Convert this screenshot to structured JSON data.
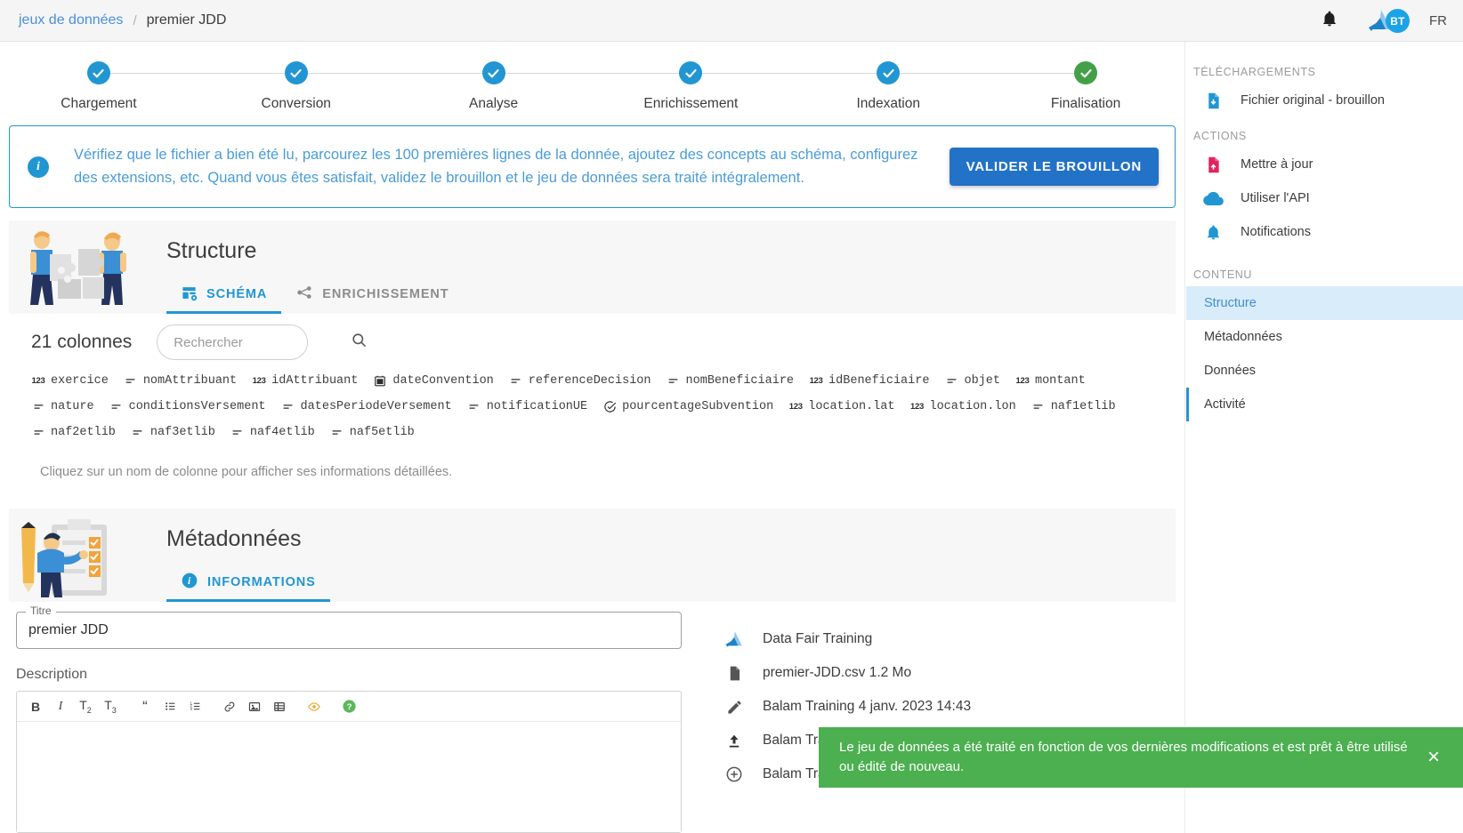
{
  "topbar": {
    "breadcrumb": {
      "parent": "jeux de données",
      "separator": "/",
      "current": "premier JDD"
    },
    "avatar_initials": "BT",
    "language": "FR"
  },
  "stepper": {
    "steps": [
      {
        "label": "Chargement",
        "state": "done",
        "color": "#2196d3"
      },
      {
        "label": "Conversion",
        "state": "done",
        "color": "#2196d3"
      },
      {
        "label": "Analyse",
        "state": "done",
        "color": "#2196d3"
      },
      {
        "label": "Enrichissement",
        "state": "done",
        "color": "#2196d3"
      },
      {
        "label": "Indexation",
        "state": "done",
        "color": "#2196d3"
      },
      {
        "label": "Finalisation",
        "state": "complete",
        "color": "#43a047"
      }
    ]
  },
  "alert": {
    "icon": "info-icon",
    "message": "Vérifiez que le fichier a bien été lu, parcourez les 100 premières lignes de la donnée, ajoutez des concepts au schéma, configurez des extensions, etc. Quand vous êtes satisfait, validez le brouillon et le jeu de données sera traité intégralement.",
    "button": "VALIDER LE BROUILLON",
    "accent": "#2196d3"
  },
  "structure": {
    "title": "Structure",
    "tabs": [
      {
        "label": "SCHÉMA",
        "icon": "table-settings-icon",
        "active": true
      },
      {
        "label": "ENRICHISSEMENT",
        "icon": "share-nodes-icon",
        "active": false
      }
    ],
    "columns_count": "21 colonnes",
    "search_placeholder": "Rechercher",
    "search_value": "",
    "hint": "Cliquez sur un nom de colonne pour afficher ses informations détaillées.",
    "columns": [
      {
        "name": "exercice",
        "type": "number"
      },
      {
        "name": "nomAttribuant",
        "type": "text"
      },
      {
        "name": "idAttribuant",
        "type": "number"
      },
      {
        "name": "dateConvention",
        "type": "date"
      },
      {
        "name": "referenceDecision",
        "type": "text"
      },
      {
        "name": "nomBeneficiaire",
        "type": "text"
      },
      {
        "name": "idBeneficiaire",
        "type": "number"
      },
      {
        "name": "objet",
        "type": "text"
      },
      {
        "name": "montant",
        "type": "number"
      },
      {
        "name": "nature",
        "type": "text"
      },
      {
        "name": "conditionsVersement",
        "type": "text"
      },
      {
        "name": "datesPeriodeVersement",
        "type": "text"
      },
      {
        "name": "notificationUE",
        "type": "text"
      },
      {
        "name": "pourcentageSubvention",
        "type": "boolean"
      },
      {
        "name": "location.lat",
        "type": "number"
      },
      {
        "name": "location.lon",
        "type": "number"
      },
      {
        "name": "naf1etlib",
        "type": "text"
      },
      {
        "name": "naf2etlib",
        "type": "text"
      },
      {
        "name": "naf3etlib",
        "type": "text"
      },
      {
        "name": "naf4etlib",
        "type": "text"
      },
      {
        "name": "naf5etlib",
        "type": "text"
      }
    ]
  },
  "metadata": {
    "title": "Métadonnées",
    "tabs": [
      {
        "label": "INFORMATIONS",
        "icon": "info-icon",
        "active": true
      }
    ],
    "title_field": {
      "legend": "Titre",
      "value": "premier JDD"
    },
    "description_label": "Description",
    "toolbar": [
      {
        "name": "bold",
        "glyph": "B"
      },
      {
        "name": "italic",
        "glyph": "I"
      },
      {
        "name": "heading-2",
        "glyph": "T₂"
      },
      {
        "name": "heading-3",
        "glyph": "T₃"
      },
      {
        "name": "quote",
        "glyph": "❝"
      },
      {
        "name": "bullet-list",
        "glyph": "list"
      },
      {
        "name": "numbered-list",
        "glyph": "numlist"
      },
      {
        "name": "link",
        "glyph": "link"
      },
      {
        "name": "image",
        "glyph": "image"
      },
      {
        "name": "table",
        "glyph": "table"
      },
      {
        "name": "preview",
        "glyph": "eye"
      },
      {
        "name": "help",
        "glyph": "?"
      }
    ],
    "info_rows": [
      {
        "icon": "datafair-logo-icon",
        "text": "Data Fair Training"
      },
      {
        "icon": "file-icon",
        "text": "premier-JDD.csv 1.2 Mo"
      },
      {
        "icon": "pencil-icon",
        "text": "Balam Training 4 janv. 2023 14:43"
      },
      {
        "icon": "upload-icon",
        "text": "Balam Training"
      },
      {
        "icon": "plus-circle-icon",
        "text": "Balam Training"
      }
    ]
  },
  "sidebar": {
    "downloads_heading": "TÉLÉCHARGEMENTS",
    "downloads": [
      {
        "icon": "file-download-icon",
        "label": "Fichier original - brouillon",
        "color": "#2196d3"
      }
    ],
    "actions_heading": "ACTIONS",
    "actions": [
      {
        "icon": "file-upload-icon",
        "label": "Mettre à jour",
        "color": "#e0245e"
      },
      {
        "icon": "cloud-icon",
        "label": "Utiliser l'API",
        "color": "#2196d3"
      },
      {
        "icon": "bell-icon",
        "label": "Notifications",
        "color": "#2196d3"
      }
    ],
    "content_heading": "CONTENU",
    "nav": [
      {
        "label": "Structure",
        "active": true,
        "marked": false
      },
      {
        "label": "Métadonnées",
        "active": false,
        "marked": false
      },
      {
        "label": "Données",
        "active": false,
        "marked": false
      },
      {
        "label": "Activité",
        "active": false,
        "marked": true
      }
    ]
  },
  "toast": {
    "message": "Le jeu de données a été traité en fonction de vos dernières modifications et est prêt à être utilisé ou édité de nouveau.",
    "close_label": "×",
    "color": "#4caf50"
  }
}
